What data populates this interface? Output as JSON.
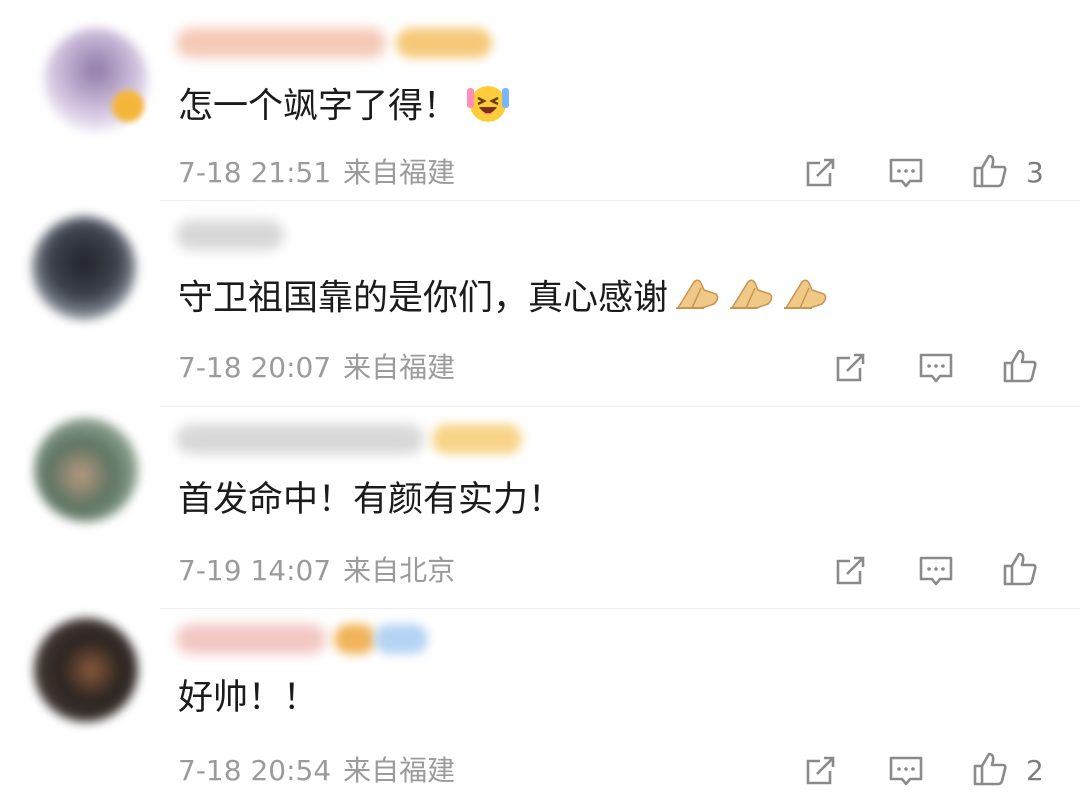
{
  "comments": [
    {
      "text": "怎一个飒字了得！",
      "emojis": [
        "laughing-face-emoji"
      ],
      "time": "7-18 21:51",
      "location": "来自福建",
      "likes": "3",
      "avatar_color": "#c9b9d8",
      "name_color": "#f4c9b6",
      "badge_color": "#f6c97a"
    },
    {
      "text": "守卫祖国靠的是你们，真心感谢",
      "emojis": [
        "pray-hands-emoji",
        "pray-hands-emoji",
        "pray-hands-emoji"
      ],
      "time": "7-18 20:07",
      "location": "来自福建",
      "likes": "",
      "avatar_color": "#3e434e",
      "name_color": "#d7d7d7",
      "badge_color": ""
    },
    {
      "text": "首发命中！有颜有实力！",
      "emojis": [],
      "time": "7-19 14:07",
      "location": "来自北京",
      "likes": "",
      "avatar_color": "#5d7462",
      "name_color": "#d8d8d8",
      "badge_color": "#f7d488"
    },
    {
      "text": "好帅！！",
      "emojis": [],
      "time": "7-18 20:54",
      "location": "来自福建",
      "likes": "2",
      "avatar_color": "#2b2421",
      "name_color": "#f2c7c2",
      "badge_color": "#b5d3f3"
    }
  ],
  "icons": {
    "share": "share-icon",
    "comment": "comment-icon",
    "like": "thumbs-up-icon"
  },
  "colors": {
    "text": "#1b1b1b",
    "meta": "#9b9b9b",
    "icon": "#8a8a8a"
  }
}
